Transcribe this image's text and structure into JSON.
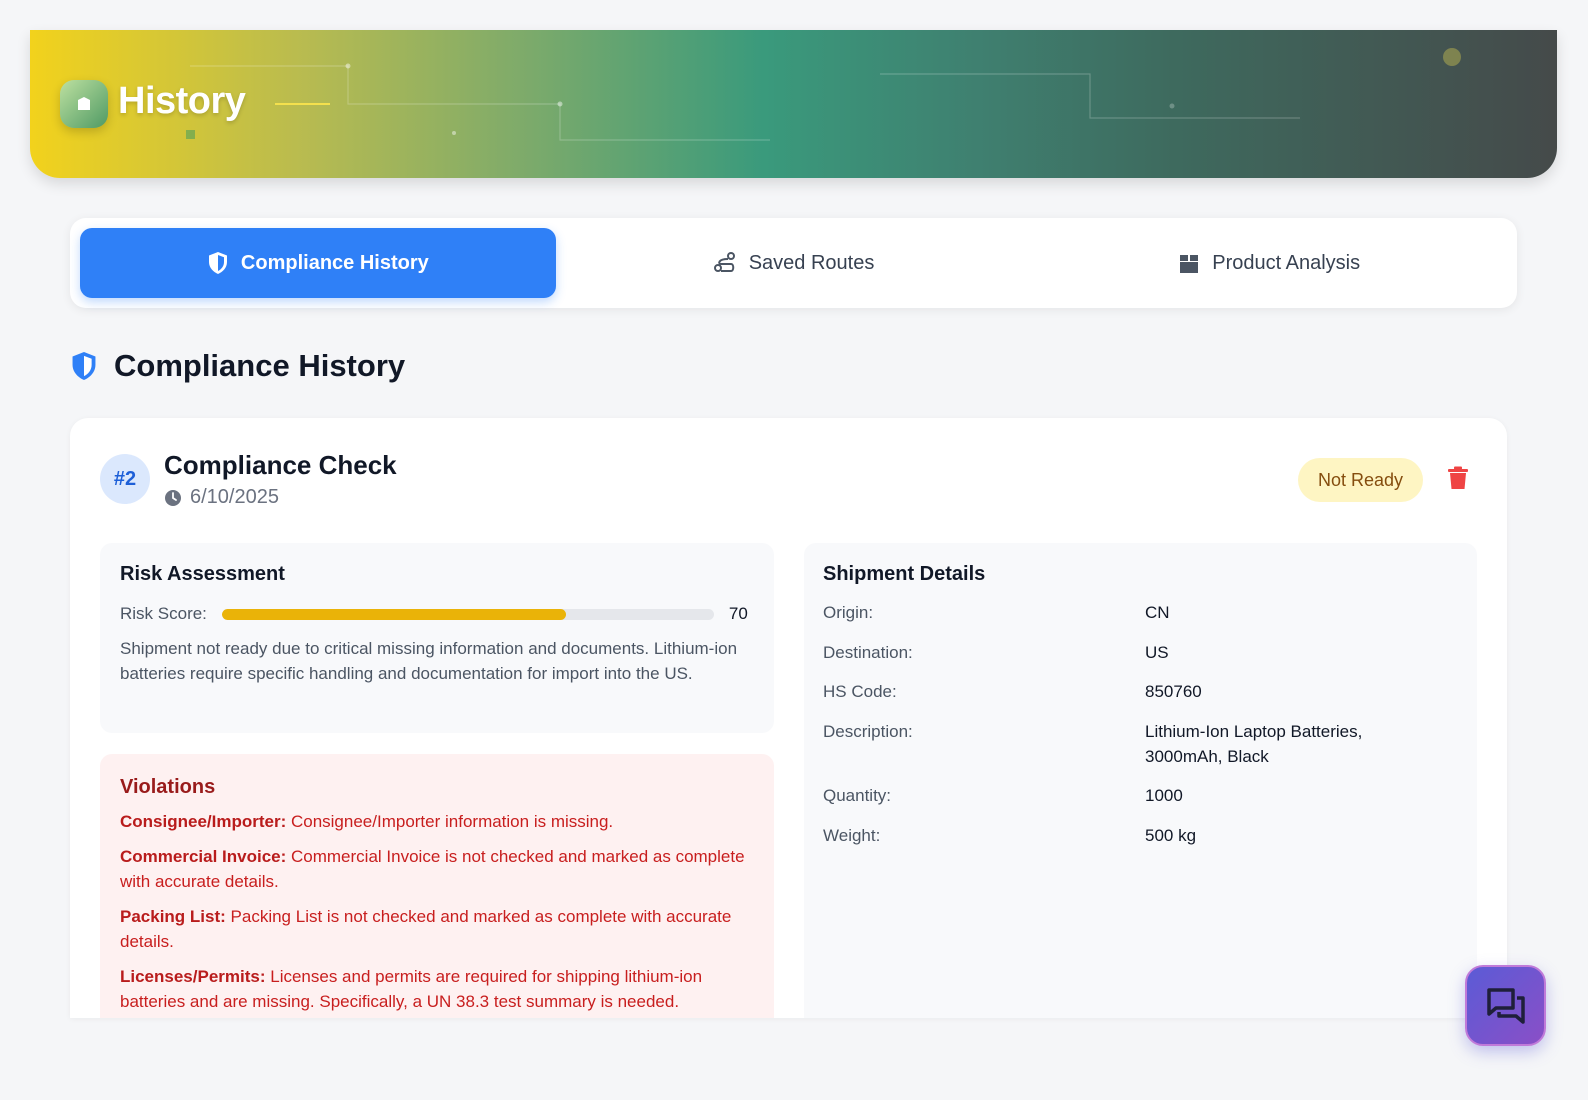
{
  "header": {
    "title": "History",
    "logo_icon": "shopping-bag-icon"
  },
  "tabs": [
    {
      "label": "Compliance History",
      "icon": "shield-icon",
      "active": true
    },
    {
      "label": "Saved Routes",
      "icon": "route-icon",
      "active": false
    },
    {
      "label": "Product Analysis",
      "icon": "box-icon",
      "active": false
    }
  ],
  "section": {
    "title": "Compliance History",
    "icon": "shield-icon"
  },
  "card": {
    "number": "#2",
    "title": "Compliance Check",
    "date": "6/10/2025",
    "status": "Not Ready",
    "risk": {
      "title": "Risk Assessment",
      "score_label": "Risk Score:",
      "score": 70,
      "score_max": 100,
      "description": "Shipment not ready due to critical missing information and documents. Lithium-ion batteries require specific handling and documentation for import into the US."
    },
    "violations": {
      "title": "Violations",
      "items": [
        {
          "label": "Consignee/Importer:",
          "text": " Consignee/Importer information is missing."
        },
        {
          "label": "Commercial Invoice:",
          "text": " Commercial Invoice is not checked and marked as complete with accurate details."
        },
        {
          "label": "Packing List:",
          "text": " Packing List is not checked and marked as complete with accurate details."
        },
        {
          "label": "Licenses/Permits:",
          "text": " Licenses and permits are required for shipping lithium-ion batteries and are missing. Specifically, a UN 38.3 test summary is needed."
        }
      ]
    },
    "shipment": {
      "title": "Shipment Details",
      "rows": [
        {
          "label": "Origin:",
          "value": "CN"
        },
        {
          "label": "Destination:",
          "value": "US"
        },
        {
          "label": "HS Code:",
          "value": "850760"
        },
        {
          "label": "Description:",
          "value": "Lithium-Ion Laptop Batteries, 3000mAh, Black"
        },
        {
          "label": "Quantity:",
          "value": "1000"
        },
        {
          "label": "Weight:",
          "value": "500 kg"
        }
      ]
    }
  },
  "colors": {
    "accent": "#2f80f7",
    "warning_bg": "#fef5c3",
    "danger": "#ef4444",
    "risk_fill": "#eab308"
  }
}
